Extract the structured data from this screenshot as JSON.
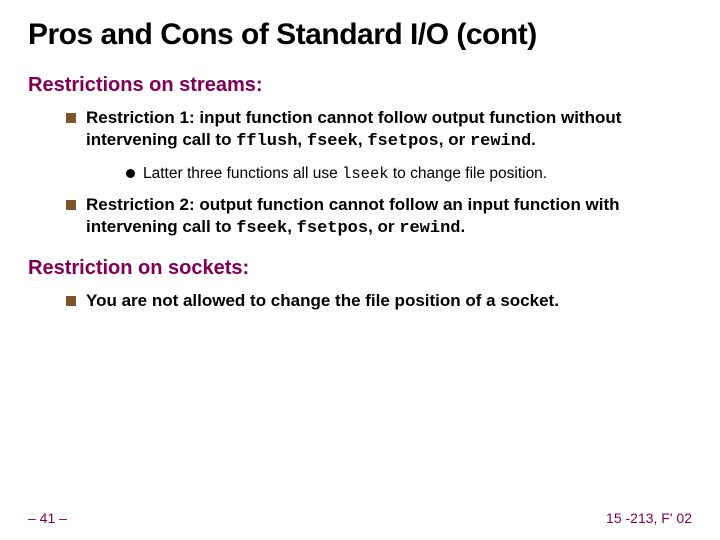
{
  "title": "Pros and Cons of Standard I/O (cont)",
  "sections": [
    {
      "heading": "Restrictions on streams:",
      "items": [
        {
          "pre": "Restriction 1: input function cannot follow output function without intervening call to ",
          "code1": "fflush",
          "mid1": ", ",
          "code2": "fseek",
          "mid2": ", ",
          "code3": "fsetpos",
          "mid3": ", or ",
          "code4": "rewind",
          "post": ".",
          "sub": {
            "pre": "Latter three functions all use ",
            "code": "lseek",
            "post": " to change file position."
          }
        },
        {
          "pre": "Restriction 2: output function cannot follow an input function with intervening call to ",
          "code1": "fseek",
          "mid1": ", ",
          "code2": "fsetpos",
          "mid2": ", or ",
          "code3": "rewind",
          "post": "."
        }
      ]
    },
    {
      "heading": "Restriction on sockets:",
      "items": [
        {
          "pre": "You are not allowed to change the file position of a socket."
        }
      ]
    }
  ],
  "footer": {
    "left": "– 41 –",
    "right": "15 -213, F' 02"
  }
}
